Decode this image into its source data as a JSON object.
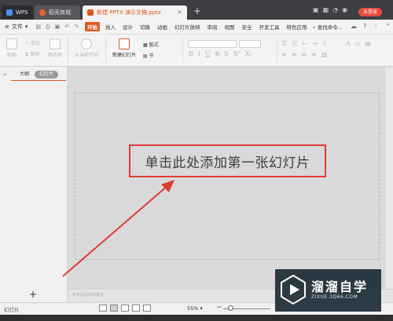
{
  "titlebar": {
    "tabs": [
      {
        "label": "WPS"
      },
      {
        "label": "稻壳商城"
      },
      {
        "label": "新建 PPTX 演示文稿.pptx"
      }
    ],
    "login_label": "未登录"
  },
  "menubar": {
    "file_label": "文件",
    "items": [
      "开始",
      "插入",
      "设计",
      "切换",
      "动画",
      "幻灯片放映",
      "审阅",
      "视图",
      "安全",
      "开发工具",
      "特色应用"
    ],
    "active_item": "开始",
    "search_label": "查找命令..."
  },
  "ribbon": {
    "paste": "粘贴",
    "cut": "剪切",
    "copy": "复制",
    "format_painter": "格式刷",
    "from_current": "从当前开始",
    "new_slide": "新建幻灯片",
    "layout": "版式",
    "section": "节"
  },
  "left_panel": {
    "tab_outline": "大纲",
    "tab_slides": "幻灯片",
    "add_slide": "+"
  },
  "slide": {
    "placeholder": "单击此处添加第一张幻灯片",
    "notes_hint": "单击此处添加备注"
  },
  "statusbar": {
    "left_label": "幻灯片",
    "zoom": "55%"
  },
  "watermark": {
    "title": "溜溜自学",
    "url": "ZIXUE.3D66.COM"
  },
  "colors": {
    "accent": "#e2571e",
    "highlight": "#e03b33",
    "titlebar": "#3d3f43"
  }
}
